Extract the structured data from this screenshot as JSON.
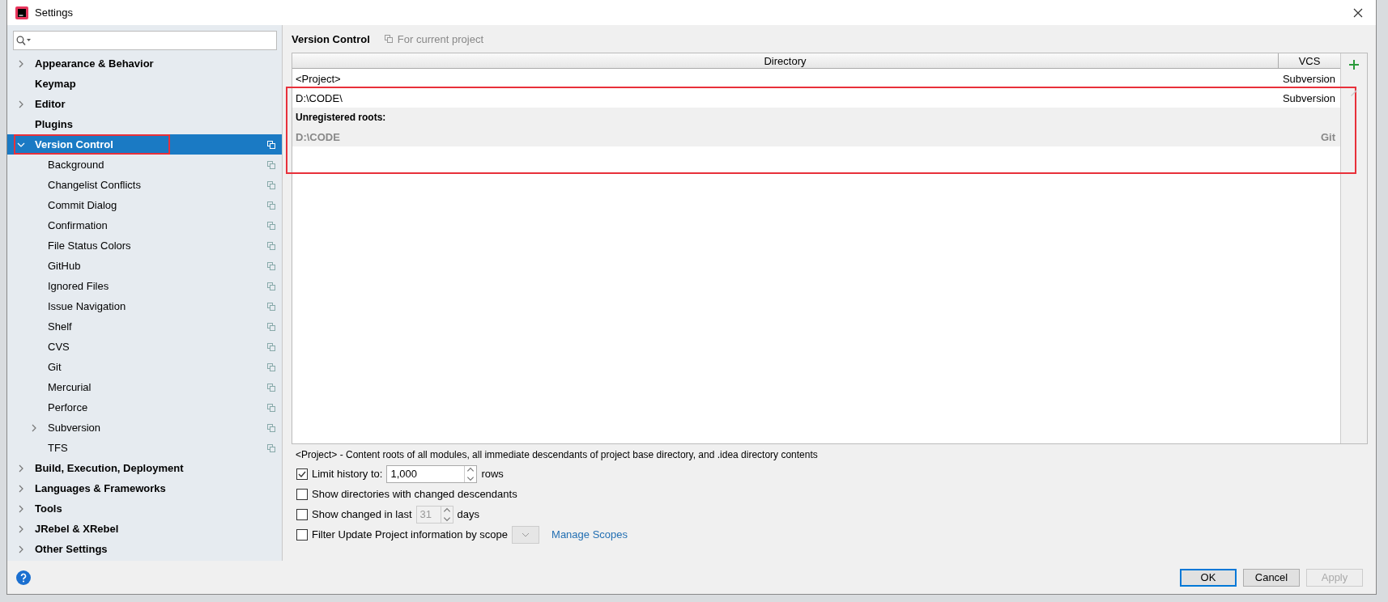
{
  "window": {
    "title": "Settings"
  },
  "sidebar": {
    "items": [
      {
        "label": "Appearance & Behavior",
        "expanded": false,
        "selected": false,
        "outlined": false,
        "project_icon": false
      },
      {
        "label": "Keymap",
        "selected": false,
        "outlined": false,
        "project_icon": false
      },
      {
        "label": "Editor",
        "expanded": false,
        "selected": false,
        "outlined": false,
        "project_icon": false
      },
      {
        "label": "Plugins",
        "selected": false,
        "outlined": false,
        "project_icon": false
      },
      {
        "label": "Version Control",
        "expanded": true,
        "selected": true,
        "outlined": true,
        "project_icon": true,
        "children": [
          {
            "label": "Background",
            "selected": false,
            "project_icon": true
          },
          {
            "label": "Changelist Conflicts",
            "selected": false,
            "project_icon": true
          },
          {
            "label": "Commit Dialog",
            "selected": false,
            "project_icon": true
          },
          {
            "label": "Confirmation",
            "selected": false,
            "project_icon": true
          },
          {
            "label": "File Status Colors",
            "selected": false,
            "project_icon": true
          },
          {
            "label": "GitHub",
            "selected": false,
            "project_icon": true
          },
          {
            "label": "Ignored Files",
            "selected": false,
            "project_icon": true
          },
          {
            "label": "Issue Navigation",
            "selected": false,
            "project_icon": true
          },
          {
            "label": "Shelf",
            "selected": false,
            "project_icon": true
          },
          {
            "label": "CVS",
            "selected": false,
            "project_icon": true
          },
          {
            "label": "Git",
            "selected": false,
            "project_icon": true
          },
          {
            "label": "Mercurial",
            "selected": false,
            "project_icon": true
          },
          {
            "label": "Perforce",
            "selected": false,
            "project_icon": true
          },
          {
            "label": "Subversion",
            "expanded": false,
            "selected": false,
            "project_icon": true
          },
          {
            "label": "TFS",
            "selected": false,
            "project_icon": true
          }
        ]
      },
      {
        "label": "Build, Execution, Deployment",
        "expanded": false,
        "selected": false,
        "outlined": false,
        "project_icon": false
      },
      {
        "label": "Languages & Frameworks",
        "expanded": false,
        "selected": false,
        "outlined": false,
        "project_icon": false
      },
      {
        "label": "Tools",
        "expanded": false,
        "selected": false,
        "outlined": false,
        "project_icon": false
      },
      {
        "label": "JRebel & XRebel",
        "expanded": false,
        "selected": false,
        "outlined": false,
        "project_icon": false
      },
      {
        "label": "Other Settings",
        "expanded": false,
        "selected": false,
        "outlined": false,
        "project_icon": false
      }
    ]
  },
  "panel": {
    "title": "Version Control",
    "scope": "For current project",
    "table": {
      "columns": [
        "Directory",
        "VCS"
      ],
      "rows": [
        {
          "kind": "mapping",
          "directory": "<Project>",
          "vcs": "Subversion",
          "outlined": false
        },
        {
          "kind": "mapping",
          "directory": "D:\\CODE\\",
          "vcs": "Subversion",
          "outlined": true
        },
        {
          "kind": "group",
          "directory": "Unregistered roots:",
          "outlined": true
        },
        {
          "kind": "unregistered",
          "directory": "D:\\CODE",
          "vcs": "Git",
          "outlined": true
        }
      ]
    },
    "note": "<Project> - Content roots of all modules, all immediate descendants of project base directory, and .idea directory contents",
    "options": [
      {
        "kind": "number",
        "label": "Limit history to:",
        "checked": true,
        "value": "1,000",
        "disabled": false,
        "suffix": "rows"
      },
      {
        "kind": "plain",
        "label": "Show directories with changed descendants",
        "checked": false
      },
      {
        "kind": "number",
        "label": "Show changed in last",
        "checked": false,
        "value": "31",
        "disabled": true,
        "suffix": "days"
      },
      {
        "kind": "scope",
        "label": "Filter Update Project information by scope",
        "checked": false,
        "link": "Manage Scopes"
      }
    ]
  },
  "buttons": [
    {
      "label": "OK",
      "default": true,
      "disabled": false
    },
    {
      "label": "Cancel",
      "default": false,
      "disabled": false
    },
    {
      "label": "Apply",
      "default": false,
      "disabled": true
    }
  ]
}
